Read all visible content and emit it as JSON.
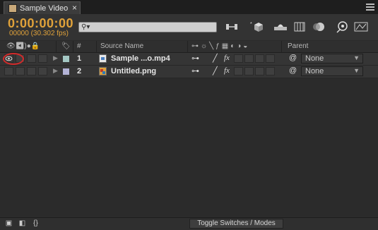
{
  "tab": {
    "title": "Sample Video",
    "close": "×"
  },
  "header": {
    "timecode": "0:00:00:00",
    "frames": "00000 (30.302 fps)",
    "search": {
      "icon": "search-icon",
      "placeholder": ""
    }
  },
  "toolbar_icons": [
    "comp-mini-flowchart-icon",
    "draft-3d-icon",
    "shy-layers-icon",
    "frame-blending-icon",
    "motion-blur-icon",
    "brainstorm-icon",
    "graph-editor-icon"
  ],
  "columns": {
    "av_features": "av-features-icons",
    "label": "label-tag-icon",
    "number": "#",
    "source_name": "Source Name",
    "switches": "switches-icons",
    "parent": "Parent"
  },
  "layers": [
    {
      "number": "1",
      "source_name": "Sample ...o.mp4",
      "label_color": "#a4c8c4",
      "parent": "None",
      "visible": true,
      "file_type": "video-file-icon"
    },
    {
      "number": "2",
      "source_name": "Untitled.png",
      "label_color": "#b3b3d6",
      "parent": "None",
      "visible": false,
      "file_type": "image-file-icon"
    }
  ],
  "annotation": {
    "highlight_color": "#d32a2a",
    "target": "eye-icon"
  },
  "footer": {
    "toggle_label": "Toggle Switches / Modes"
  },
  "colors": {
    "timecode": "#e0a23a",
    "panel_bg": "#2b2b2b"
  }
}
